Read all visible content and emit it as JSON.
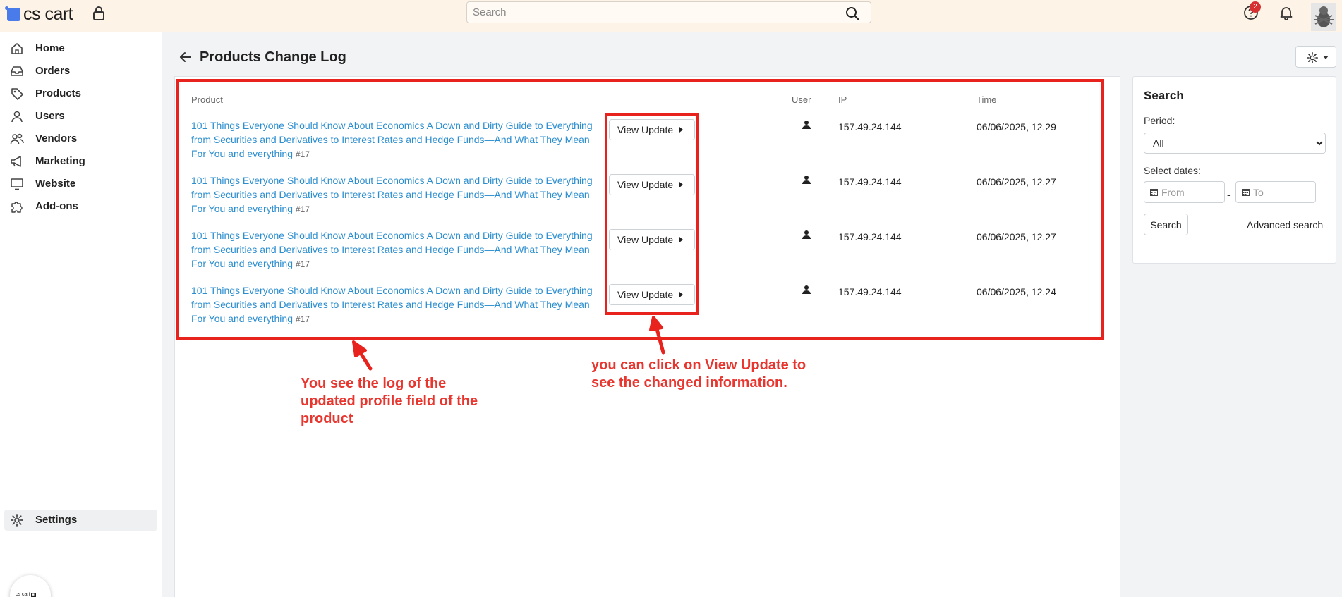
{
  "header": {
    "logo_text": "cs cart",
    "search_placeholder": "Search",
    "help_badge_count": "2"
  },
  "sidebar": {
    "items": [
      {
        "label": "Home",
        "icon": "home-icon"
      },
      {
        "label": "Orders",
        "icon": "inbox-icon"
      },
      {
        "label": "Products",
        "icon": "tag-icon"
      },
      {
        "label": "Users",
        "icon": "user-icon"
      },
      {
        "label": "Vendors",
        "icon": "users-icon"
      },
      {
        "label": "Marketing",
        "icon": "megaphone-icon"
      },
      {
        "label": "Website",
        "icon": "monitor-icon"
      },
      {
        "label": "Add-ons",
        "icon": "puzzle-icon"
      }
    ],
    "settings_label": "Settings",
    "bottom_logo_text": "cs cart"
  },
  "page": {
    "title": "Products Change Log"
  },
  "table": {
    "headers": {
      "product": "Product",
      "user": "User",
      "ip": "IP",
      "time": "Time"
    },
    "view_update_label": "View Update",
    "rows": [
      {
        "product": "101 Things Everyone Should Know About Economics A Down and Dirty Guide to Everything from Securities and Derivatives to Interest Rates and Hedge Funds—And What They Mean For You and everything",
        "product_id": "#17",
        "ip": "157.49.24.144",
        "time": "06/06/2025, 12.29"
      },
      {
        "product": "101 Things Everyone Should Know About Economics A Down and Dirty Guide to Everything from Securities and Derivatives to Interest Rates and Hedge Funds—And What They Mean For You and everything",
        "product_id": "#17",
        "ip": "157.49.24.144",
        "time": "06/06/2025, 12.27"
      },
      {
        "product": "101 Things Everyone Should Know About Economics A Down and Dirty Guide to Everything from Securities and Derivatives to Interest Rates and Hedge Funds—And What They Mean For You and everything",
        "product_id": "#17",
        "ip": "157.49.24.144",
        "time": "06/06/2025, 12.27"
      },
      {
        "product": "101 Things Everyone Should Know About Economics A Down and Dirty Guide to Everything from Securities and Derivatives to Interest Rates and Hedge Funds—And What They Mean For You and everything",
        "product_id": "#17",
        "ip": "157.49.24.144",
        "time": "06/06/2025, 12.24"
      }
    ]
  },
  "search_panel": {
    "title": "Search",
    "period_label": "Period:",
    "period_selected": "All",
    "select_dates_label": "Select dates:",
    "from_placeholder": "From",
    "to_placeholder": "To",
    "date_separator": "-",
    "search_button": "Search",
    "advanced_search": "Advanced search"
  },
  "annotations": {
    "log_note_line1": "You see the log of the",
    "log_note_line2": "updated profile field of the",
    "log_note_line3": "product",
    "view_note_line1": "you can click on View Update to",
    "view_note_line2": "see the changed information.",
    "color": "#e8231d"
  }
}
